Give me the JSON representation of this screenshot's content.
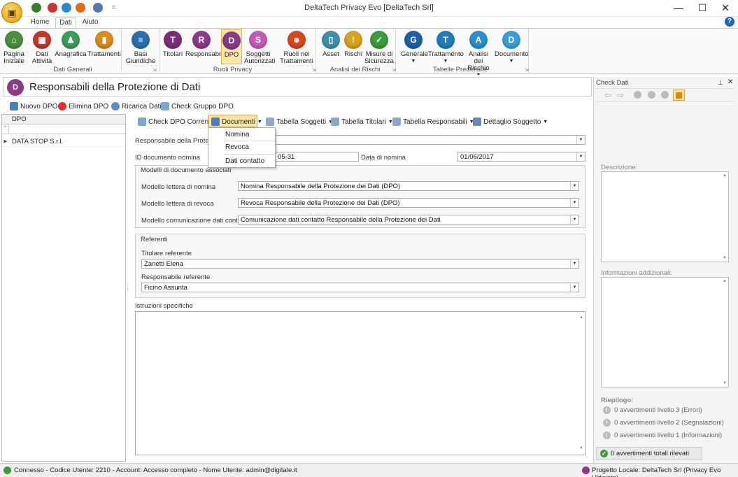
{
  "window": {
    "title": "DeltaTech Privacy Evo [DeltaTech Srl]",
    "minimize": "—",
    "maximize": "☐",
    "close": "✕",
    "qat_more": "="
  },
  "ribbon_tabs": [
    "Home",
    "Dati",
    "Aiuto"
  ],
  "help_glyph": "?",
  "ribbon": {
    "buttons": [
      {
        "l1": "Pagina",
        "l2": "Iniziale",
        "icon": "home-icon",
        "color": "#4a8f3c",
        "g": "⌂"
      },
      {
        "l1": "Dati",
        "l2": "Attività",
        "icon": "factory-icon",
        "color": "#c0392b",
        "g": "▦"
      },
      {
        "l1": "Anagrafica",
        "l2": "",
        "icon": "person-icon",
        "color": "#3d9c55",
        "g": "♟"
      },
      {
        "l1": "Trattamenti",
        "l2": "",
        "icon": "processing-icon",
        "color": "#d98c1c",
        "g": "▮"
      },
      {
        "l1": "Basi",
        "l2": "Giuridiche",
        "icon": "legal-bases-icon",
        "color": "#2a6fb0",
        "g": "≡"
      },
      {
        "l1": "Titolari",
        "l2": "",
        "icon": "owners-icon",
        "color": "#7a2d7a",
        "g": "T"
      },
      {
        "l1": "Responsabili",
        "l2": "",
        "icon": "managers-icon",
        "color": "#8a3a86",
        "g": "R"
      },
      {
        "l1": "DPO",
        "l2": "",
        "icon": "dpo-icon",
        "color": "#8a3a86",
        "g": "D"
      },
      {
        "l1": "Soggetti",
        "l2": "Autorizzati",
        "icon": "authorized-icon",
        "color": "#c55ab6",
        "g": "S"
      },
      {
        "l1": "Ruoli nei",
        "l2": "Trattamenti",
        "icon": "roles-icon",
        "color": "#d8461f",
        "g": "☻"
      },
      {
        "l1": "Asset",
        "l2": "",
        "icon": "asset-icon",
        "color": "#3e8fa8",
        "g": "▯"
      },
      {
        "l1": "Rischi",
        "l2": "",
        "icon": "risk-warning-icon",
        "color": "#d9a21c",
        "g": "!"
      },
      {
        "l1": "Misure di",
        "l2": "Sicurezza",
        "icon": "security-shield-icon",
        "color": "#3a9c3a",
        "g": "✓"
      },
      {
        "l1": "Generale",
        "l2": "",
        "icon": "table-general-icon",
        "color": "#1e5fa8",
        "g": "G"
      },
      {
        "l1": "Trattamento",
        "l2": "",
        "icon": "table-processing-icon",
        "color": "#1e7fb8",
        "g": "T"
      },
      {
        "l1": "Analisi dei",
        "l2": "Rischio",
        "icon": "table-risk-icon",
        "color": "#2a8fd0",
        "g": "A"
      },
      {
        "l1": "Documento",
        "l2": "",
        "icon": "table-document-icon",
        "color": "#3ba0d8",
        "g": "D"
      }
    ],
    "groups": [
      "Dati Generali",
      "Ruoli Privacy",
      "Analisi dei Rischi",
      "Tabelle Predefinite"
    ]
  },
  "page": {
    "title": "Responsabili della Protezione di Dati",
    "icon_glyph": "D"
  },
  "list_toolbar": {
    "new": "Nuovo DPO",
    "delete": "Elimina DPO",
    "reload": "Ricarica Dati",
    "check_group": "Check Gruppo DPO"
  },
  "grid": {
    "header": "DPO",
    "filter_glyph": "ꟹ",
    "rows": [
      "DATA STOP S.r.l."
    ]
  },
  "form_toolbar": {
    "check_current": "Check DPO Corrente",
    "documents": "Documenti",
    "subjects": "Tabella Soggetti",
    "owners": "Tabella Titolari",
    "managers": "Tabella Responsabili",
    "subject_detail": "Dettaglio Soggetto"
  },
  "documents_menu": [
    "Nomina",
    "Revoca",
    "Dati contatto"
  ],
  "form": {
    "responsible_label": "Responsabile della Protezione dei Dati",
    "responsible_value": "",
    "id_label": "ID documento nomina",
    "id_value": "05-31",
    "date_label": "Data di nomina",
    "date_value": "01/06/2017",
    "models_title": "Modelli di documento associati",
    "model_nomina_label": "Modello lettera di nomina",
    "model_nomina_value": "Nomina Responsabile della Protezione dei Dati (DPO)",
    "model_revoca_label": "Modello lettera di revoca",
    "model_revoca_value": "Revoca Responsabile della Protezione dei Dati (DPO)",
    "model_contact_label": "Modello comunicazione dati contatto",
    "model_contact_value": "Comunicazione dati contatto Responsabile della Protezione dei Dati",
    "referents_title": "Referenti",
    "owner_ref_label": "Titolare referente",
    "owner_ref_value": "Zanetti Elena",
    "manager_ref_label": "Responsabile referente",
    "manager_ref_value": "Ficino Assunta",
    "instructions_label": "Istruzioni specifiche",
    "instructions_value": ""
  },
  "check_panel": {
    "title": "Check Dati",
    "pin": "⊥",
    "close": "✕",
    "description_label": "Descrizione:",
    "info_label": "Informazioni addizionali:",
    "summary_label": "Riepilogo:",
    "level3": "0 avvertimenti livello 3 (Errori)",
    "level2": "0 avvertimenti livello 2 (Segnalazioni)",
    "level1": "0 avvertimenti livello 1 (Informazioni)",
    "total": "0 avvertimenti totali rilevati"
  },
  "status": {
    "left": "Connesso - Codice Utente: 2210 - Account: Accesso completo - Nome Utente: admin@digitale.it",
    "right": "Progetto Locale: DeltaTech Srl (Privacy Evo Ultimate)"
  }
}
